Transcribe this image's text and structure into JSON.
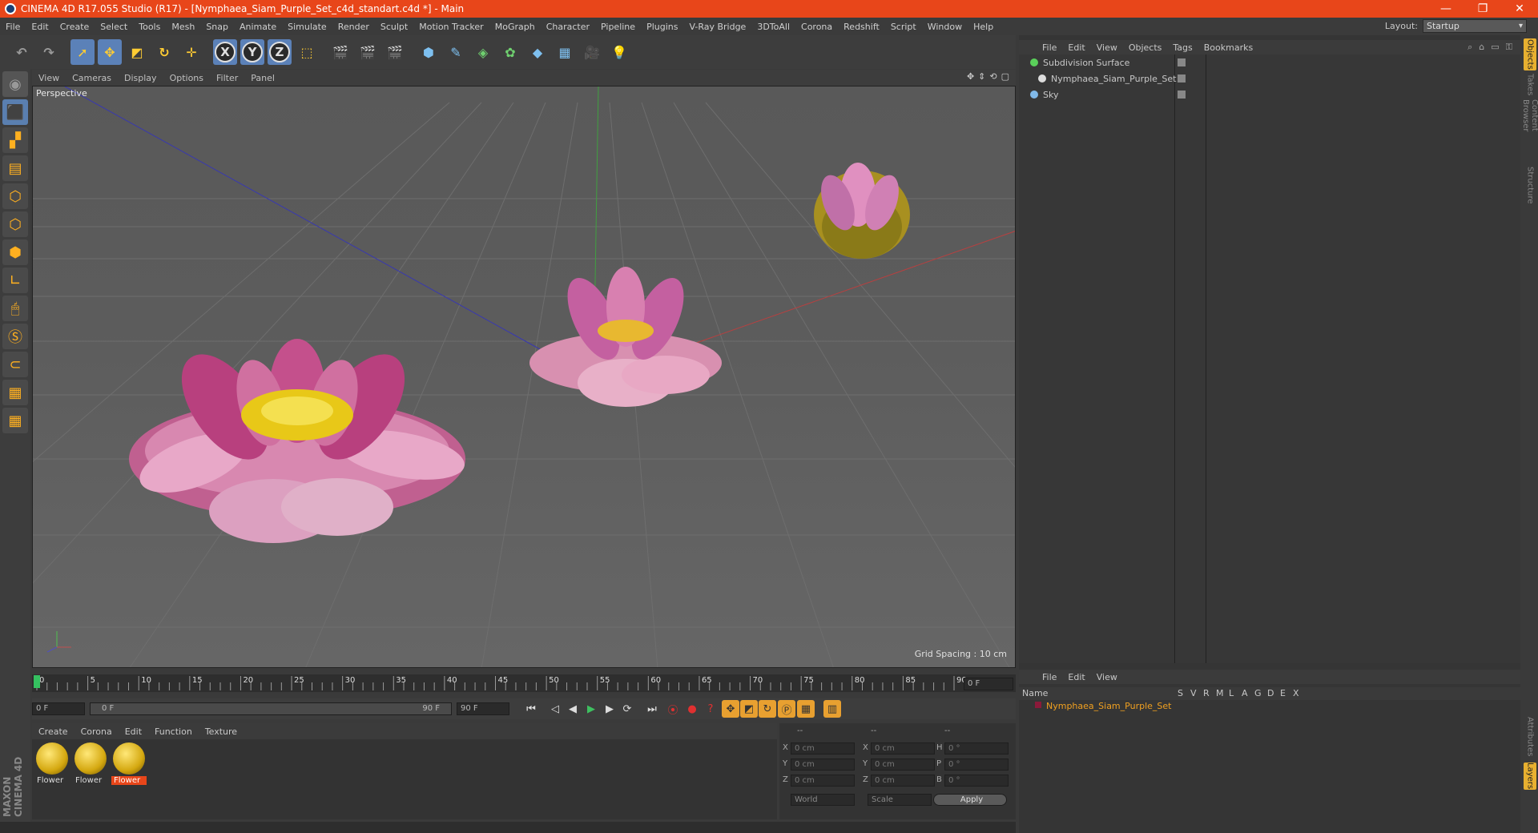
{
  "window": {
    "title": "CINEMA 4D R17.055 Studio (R17) - [Nymphaea_Siam_Purple_Set_c4d_standart.c4d *] - Main"
  },
  "menu": [
    "File",
    "Edit",
    "Create",
    "Select",
    "Tools",
    "Mesh",
    "Snap",
    "Animate",
    "Simulate",
    "Render",
    "Sculpt",
    "Motion Tracker",
    "MoGraph",
    "Character",
    "Pipeline",
    "Plugins",
    "V-Ray Bridge",
    "3DToAll",
    "Corona",
    "Redshift",
    "Script",
    "Window",
    "Help"
  ],
  "layout": {
    "label": "Layout:",
    "value": "Startup"
  },
  "toolbar": {
    "axis_x": "X",
    "axis_y": "Y",
    "axis_z": "Z"
  },
  "viewport": {
    "menu": [
      "View",
      "Cameras",
      "Display",
      "Options",
      "Filter",
      "Panel"
    ],
    "label": "Perspective",
    "grid_spacing": "Grid Spacing : 10 cm"
  },
  "timeline": {
    "ticks": [
      "0",
      "5",
      "10",
      "15",
      "20",
      "25",
      "30",
      "35",
      "40",
      "45",
      "50",
      "55",
      "60",
      "65",
      "70",
      "75",
      "80",
      "85",
      "90"
    ],
    "end_field": "0 F",
    "start_field": "0 F",
    "range_start": "0 F",
    "range_end": "90 F",
    "max_field": "90 F",
    "current": 0,
    "max": 90
  },
  "materials": {
    "menu": [
      "Create",
      "Corona",
      "Edit",
      "Function",
      "Texture"
    ],
    "items": [
      {
        "label": "Flower"
      },
      {
        "label": "Flower"
      },
      {
        "label": "Flower"
      }
    ]
  },
  "coords": {
    "headers": [
      "--",
      "--",
      "--"
    ],
    "rows": [
      {
        "a": "X",
        "av": "0 cm",
        "b": "X",
        "bv": "0 cm",
        "c": "H",
        "cv": "0 °"
      },
      {
        "a": "Y",
        "av": "0 cm",
        "b": "Y",
        "bv": "0 cm",
        "c": "P",
        "cv": "0 °"
      },
      {
        "a": "Z",
        "av": "0 cm",
        "b": "Z",
        "bv": "0 cm",
        "c": "B",
        "cv": "0 °"
      }
    ],
    "world": "World",
    "scale": "Scale",
    "apply": "Apply"
  },
  "objects": {
    "menu": [
      "File",
      "Edit",
      "View",
      "Objects",
      "Tags",
      "Bookmarks"
    ],
    "items": [
      {
        "name": "Subdivision Surface"
      },
      {
        "name": "Nymphaea_Siam_Purple_Set"
      },
      {
        "name": "Sky"
      }
    ]
  },
  "layers": {
    "menu": [
      "File",
      "Edit",
      "View"
    ],
    "columns": [
      "Name",
      "S",
      "V",
      "R",
      "M",
      "L",
      "A",
      "G",
      "D",
      "E",
      "X"
    ],
    "row": "Nymphaea_Siam_Purple_Set"
  },
  "sidetabs": [
    "Objects",
    "Takes",
    "Content Browser",
    "Structure",
    "Attributes",
    "Layers"
  ],
  "branding": "MAXON CINEMA 4D",
  "colors": {
    "accent": "#e8461a",
    "select": "#5b81b8",
    "material_label": "#f0a020"
  }
}
